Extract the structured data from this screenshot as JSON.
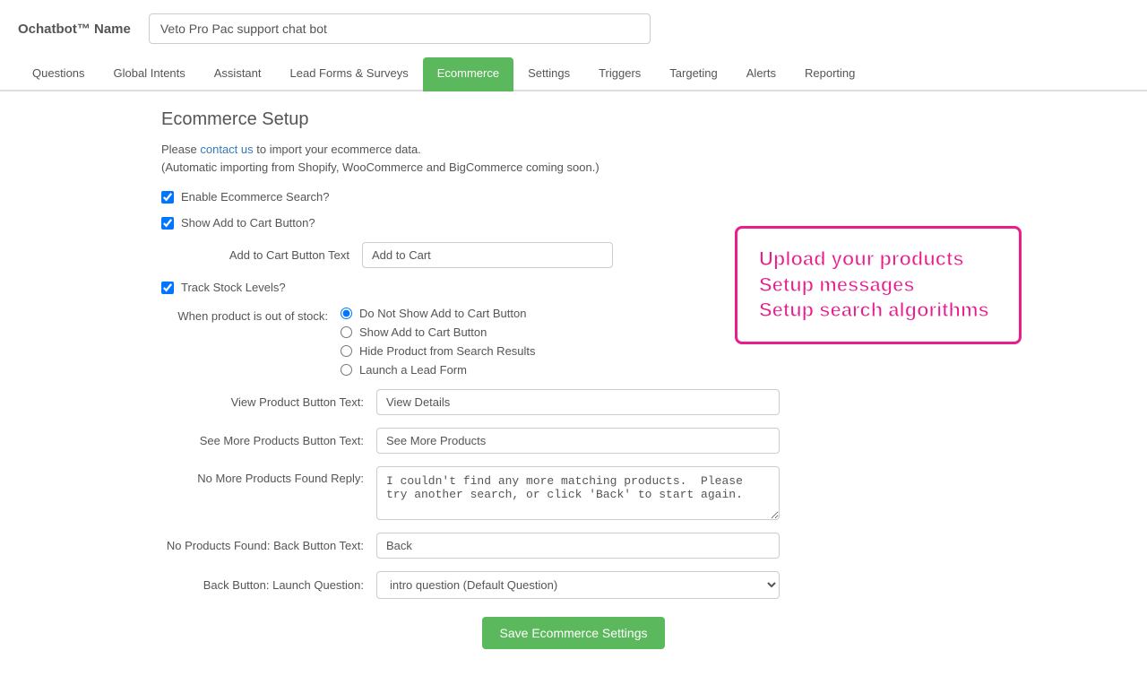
{
  "header": {
    "title": "Ochatbot™ Name",
    "bot_name": "Veto Pro Pac support chat bot"
  },
  "nav": {
    "items": [
      {
        "label": "Questions",
        "active": false
      },
      {
        "label": "Global Intents",
        "active": false
      },
      {
        "label": "Assistant",
        "active": false
      },
      {
        "label": "Lead Forms & Surveys",
        "active": false
      },
      {
        "label": "Ecommerce",
        "active": true
      },
      {
        "label": "Settings",
        "active": false
      },
      {
        "label": "Triggers",
        "active": false
      },
      {
        "label": "Targeting",
        "active": false
      },
      {
        "label": "Alerts",
        "active": false
      },
      {
        "label": "Reporting",
        "active": false
      }
    ]
  },
  "main": {
    "section_title": "Ecommerce Setup",
    "intro_line1": "Please",
    "intro_link": "contact us",
    "intro_line2": " to import your ecommerce data.",
    "intro_line3": "(Automatic importing from Shopify, WooCommerce and BigCommerce coming soon.)",
    "promo": {
      "line1": "Upload your products",
      "line2": "Setup messages",
      "line3": "Setup search algorithms"
    },
    "enable_label": "Enable Ecommerce Search?",
    "show_add_cart_label": "Show Add to Cart Button?",
    "add_cart_button_text_label": "Add to Cart Button Text",
    "add_cart_button_text_value": "Add to Cart",
    "track_stock_label": "Track Stock Levels?",
    "out_of_stock_label": "When product is out of stock:",
    "out_of_stock_options": [
      {
        "label": "Do Not Show Add to Cart Button",
        "value": "donotshow",
        "checked": true
      },
      {
        "label": "Show Add to Cart Button",
        "value": "show",
        "checked": false
      },
      {
        "label": "Hide Product from Search Results",
        "value": "hide",
        "checked": false
      },
      {
        "label": "Launch a Lead Form",
        "value": "leadform",
        "checked": false
      }
    ],
    "view_product_label": "View Product Button Text:",
    "view_product_value": "View Details",
    "see_more_label": "See More Products Button Text:",
    "see_more_value": "See More Products",
    "no_more_label": "No More Products Found Reply:",
    "no_more_value": "I couldn't find any more matching products.  Please try another search, or click 'Back' to start again.",
    "no_products_label": "No Products Found: Back Button Text:",
    "no_products_value": "Back",
    "back_launch_label": "Back Button: Launch Question:",
    "back_launch_value": "intro question (Default Question)",
    "back_launch_options": [
      {
        "label": "intro question (Default Question)",
        "value": "intro"
      }
    ],
    "save_label": "Save Ecommerce Settings"
  }
}
